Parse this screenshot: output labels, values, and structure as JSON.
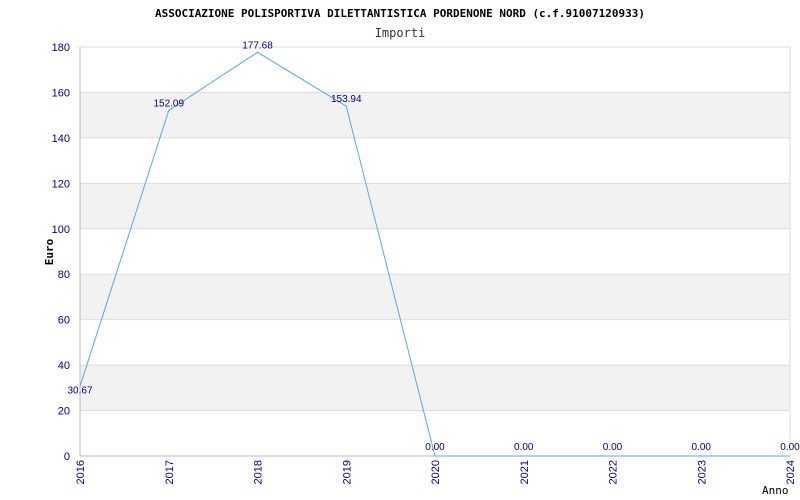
{
  "chart_data": {
    "type": "line",
    "title": "ASSOCIAZIONE POLISPORTIVA DILETTANTISTICA PORDENONE NORD (c.f.91007120933)",
    "subtitle": "Importi",
    "xlabel": "Anno",
    "ylabel": "Euro",
    "categories": [
      "2016",
      "2017",
      "2018",
      "2019",
      "2020",
      "2021",
      "2022",
      "2023",
      "2024"
    ],
    "series": [
      {
        "values": [
          30.67,
          152.09,
          177.68,
          153.94,
          0.0,
          0.0,
          0.0,
          0.0,
          0.0
        ],
        "labels": [
          "30.67",
          "152.09",
          "177.68",
          "153.94",
          "0.00",
          "0.00",
          "0.00",
          "0.00",
          "0.00"
        ],
        "color": "#5aa8e8"
      }
    ],
    "ylim": [
      0,
      180
    ],
    "yticks": [
      0,
      20,
      40,
      60,
      80,
      100,
      120,
      140,
      160,
      180
    ],
    "grid": true,
    "band_color": "#f2f2f2",
    "grid_color": "#dddddd",
    "tick_color": "#00008b"
  }
}
